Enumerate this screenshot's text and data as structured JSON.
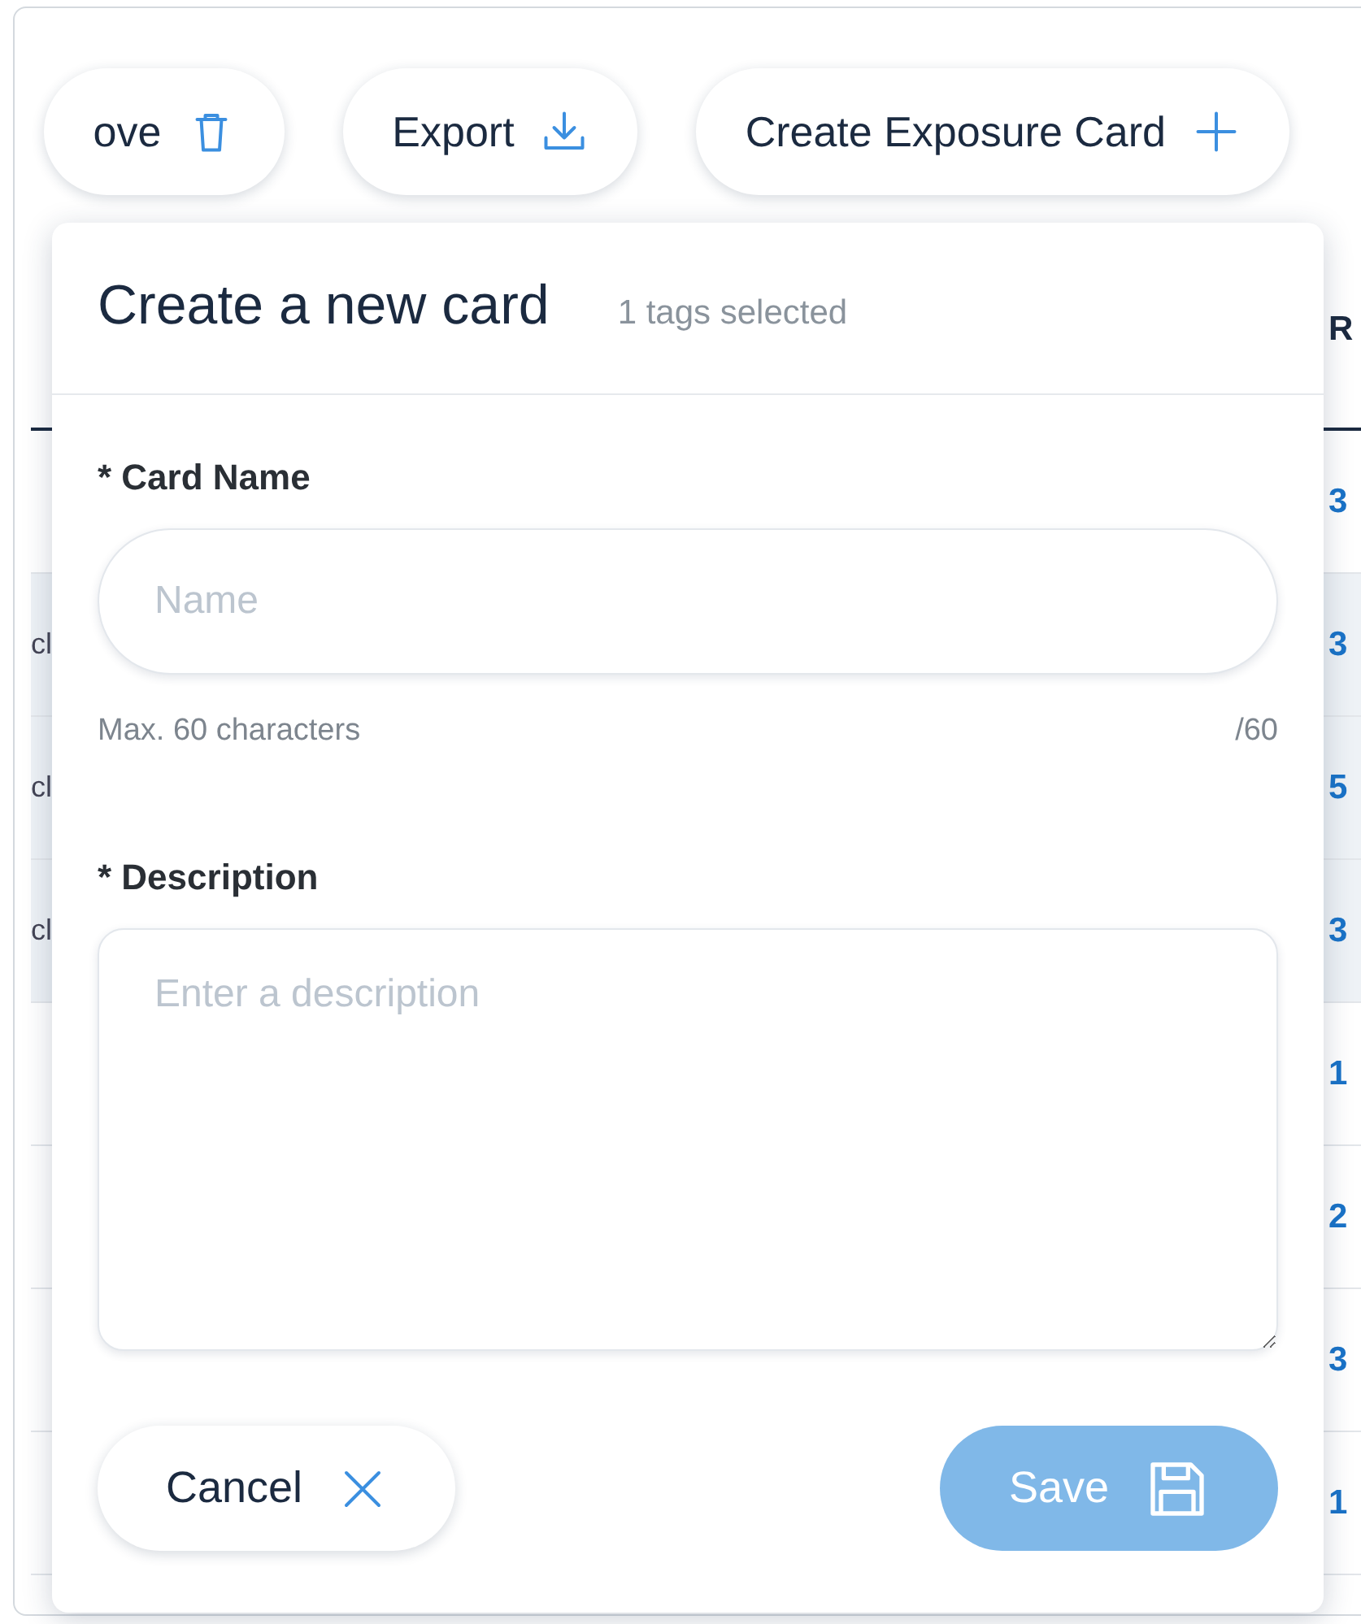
{
  "toolbar": {
    "buttons": [
      {
        "label": "ove"
      },
      {
        "label": "Export"
      },
      {
        "label": "Create Exposure Card"
      }
    ]
  },
  "table": {
    "header": {
      "column_2": "R"
    },
    "rows": [
      {
        "column_2": "3"
      },
      {
        "column_1": "cl",
        "column_2": "3"
      },
      {
        "column_1": "cl",
        "column_2": "5"
      },
      {
        "column_1": "cl",
        "column_2": "3"
      },
      {
        "column_2": "1"
      },
      {
        "column_2": "2"
      },
      {
        "column_2": "3"
      },
      {
        "column_2": "1"
      }
    ]
  },
  "dialog": {
    "title": "Create a new card",
    "subtitle": "1 tags selected",
    "fields": [
      {
        "kind": "input",
        "label": "* Card Name",
        "placeholder": "Name",
        "hint": "Max. 60 characters",
        "counter": "/60"
      },
      {
        "kind": "textarea",
        "label": "* Description",
        "placeholder": "Enter a description"
      }
    ],
    "cancel": {
      "label": "Cancel"
    },
    "save": {
      "label": "Save",
      "disabled": true
    }
  }
}
